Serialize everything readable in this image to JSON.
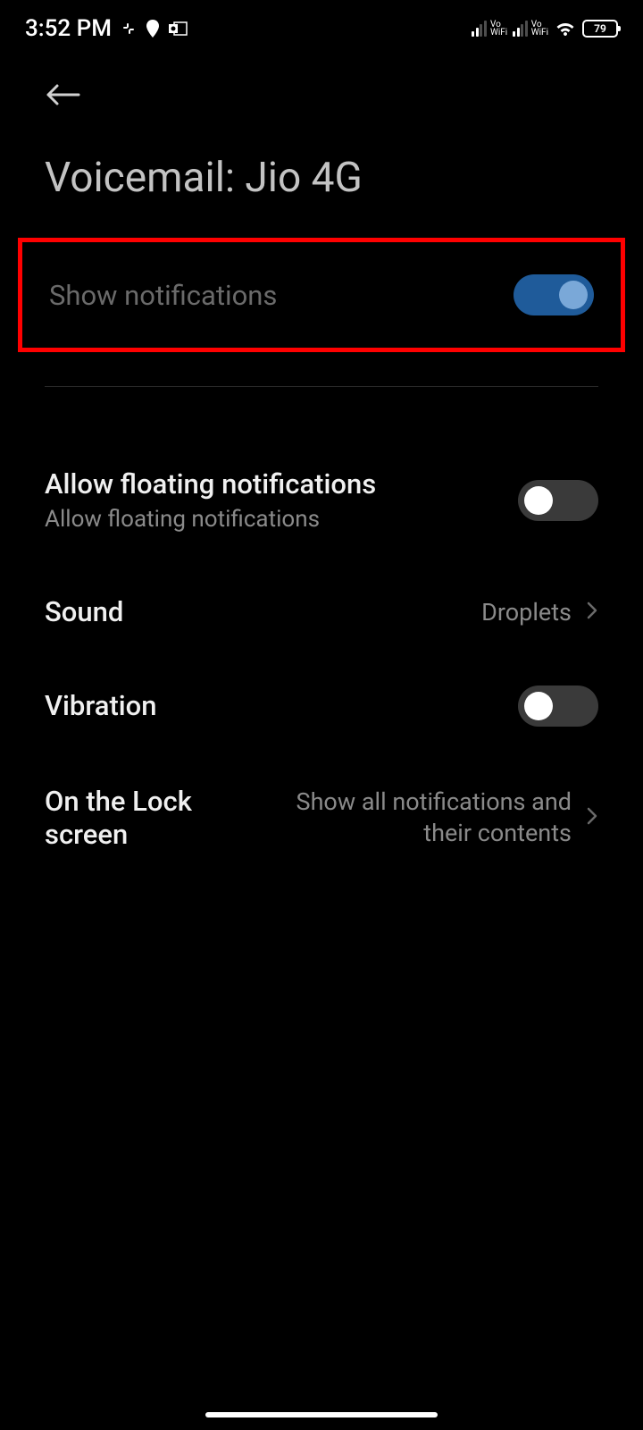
{
  "status_bar": {
    "time": "3:52 PM",
    "battery": "79"
  },
  "header": {
    "title": "Voicemail: Jio 4G"
  },
  "settings": {
    "show_notifications": {
      "label": "Show notifications",
      "enabled": true
    },
    "floating": {
      "title": "Allow floating notifications",
      "subtitle": "Allow floating notifications",
      "enabled": false
    },
    "sound": {
      "title": "Sound",
      "value": "Droplets"
    },
    "vibration": {
      "title": "Vibration",
      "enabled": false
    },
    "lock_screen": {
      "title": "On the Lock screen",
      "value": "Show all notifications and their contents"
    }
  }
}
